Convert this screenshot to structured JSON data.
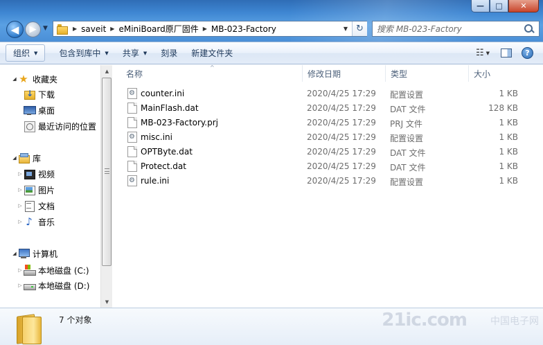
{
  "window": {
    "min_label": "—",
    "max_label": "□",
    "close_label": "✕"
  },
  "nav": {
    "back_label": "◀",
    "forward_label": "▶",
    "history_label": "▼"
  },
  "address": {
    "crumbs": [
      "saveit",
      "eMiniBoard原厂固件",
      "MB-023-Factory"
    ],
    "separator": "▶",
    "dropdown_label": "▼",
    "refresh_label": "↻"
  },
  "search": {
    "placeholder": "搜索 MB-023-Factory"
  },
  "toolbar": {
    "organize": "组织",
    "include_library": "包含到库中",
    "share": "共享",
    "burn": "刻录",
    "new_folder": "新建文件夹",
    "dropdown_arrow": "▼",
    "views_glyph": "☷",
    "help_glyph": "?"
  },
  "sidebar": {
    "collapse_glyph": "◢",
    "expand_glyph": "▷",
    "favorites": "收藏夹",
    "favorites_items": [
      "下载",
      "桌面",
      "最近访问的位置"
    ],
    "libraries": "库",
    "library_items": [
      "视频",
      "图片",
      "文档",
      "音乐"
    ],
    "computer": "计算机",
    "computer_items": [
      "本地磁盘 (C:)",
      "本地磁盘 (D:)"
    ],
    "scroll_up": "▲",
    "scroll_down": "▼"
  },
  "columns": {
    "name": "名称",
    "date": "修改日期",
    "type": "类型",
    "size": "大小",
    "sort_indicator": "^"
  },
  "files": [
    {
      "name": "counter.ini",
      "date": "2020/4/25 17:29",
      "type": "配置设置",
      "size": "1 KB",
      "icon": "ini-settings-icon"
    },
    {
      "name": "MainFlash.dat",
      "date": "2020/4/25 17:29",
      "type": "DAT 文件",
      "size": "128 KB",
      "icon": "file-icon"
    },
    {
      "name": "MB-023-Factory.prj",
      "date": "2020/4/25 17:29",
      "type": "PRJ 文件",
      "size": "1 KB",
      "icon": "file-icon"
    },
    {
      "name": "misc.ini",
      "date": "2020/4/25 17:29",
      "type": "配置设置",
      "size": "1 KB",
      "icon": "ini-settings-icon"
    },
    {
      "name": "OPTByte.dat",
      "date": "2020/4/25 17:29",
      "type": "DAT 文件",
      "size": "1 KB",
      "icon": "file-icon"
    },
    {
      "name": "Protect.dat",
      "date": "2020/4/25 17:29",
      "type": "DAT 文件",
      "size": "1 KB",
      "icon": "file-icon"
    },
    {
      "name": "rule.ini",
      "date": "2020/4/25 17:29",
      "type": "配置设置",
      "size": "1 KB",
      "icon": "ini-settings-icon"
    }
  ],
  "status": {
    "count": "7 个对象"
  },
  "watermark": {
    "logo": "21ic.com",
    "cn": "中国电子网"
  }
}
